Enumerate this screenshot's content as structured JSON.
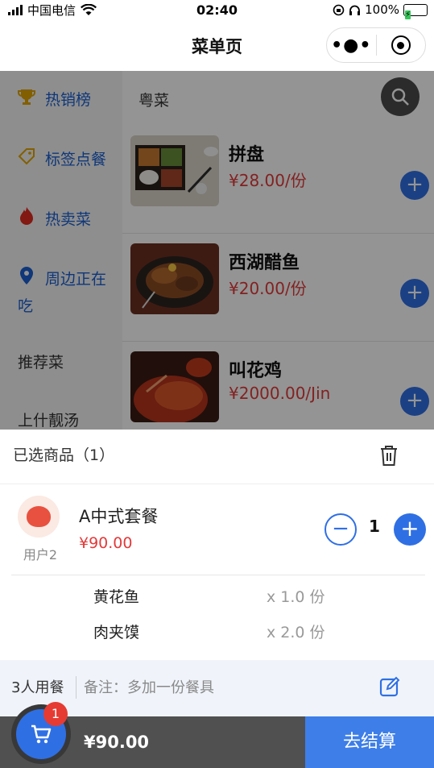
{
  "status_bar": {
    "carrier": "中国电信",
    "time": "02:40",
    "battery": "100%"
  },
  "navbar": {
    "title": "菜单页"
  },
  "sidebar": {
    "items": [
      {
        "label": "热销榜",
        "icon": "trophy-icon"
      },
      {
        "label": "标签点餐",
        "icon": "tag-icon"
      },
      {
        "label": "热卖菜",
        "icon": "fire-icon"
      },
      {
        "label": "周边正在吃",
        "icon": "location-icon"
      },
      {
        "label": "推荐菜",
        "icon": ""
      },
      {
        "label": "上什靓汤",
        "icon": ""
      }
    ]
  },
  "content": {
    "category": "粤菜",
    "dishes": [
      {
        "name": "拼盘",
        "price": "¥28.00/份"
      },
      {
        "name": "西湖醋鱼",
        "price": "¥20.00/份"
      },
      {
        "name": "叫花鸡",
        "price": "¥2000.00/Jin"
      }
    ]
  },
  "cart_sheet": {
    "header": "已选商品（1）",
    "order": {
      "user": "用户2",
      "name": "A中式套餐",
      "price": "¥90.00",
      "quantity": "1",
      "items": [
        {
          "name": "黄花鱼",
          "qty": "x 1.0 份"
        },
        {
          "name": "肉夹馍",
          "qty": "x 2.0 份"
        }
      ]
    },
    "diners": "3人用餐",
    "remark": "备注：多加一份餐具"
  },
  "bottom_bar": {
    "total": "¥90.00",
    "checkout": "去结算",
    "badge": "1"
  },
  "colors": {
    "accent": "#2f6fe4",
    "price": "#e23a3a",
    "checkout": "#3d7ee8"
  }
}
